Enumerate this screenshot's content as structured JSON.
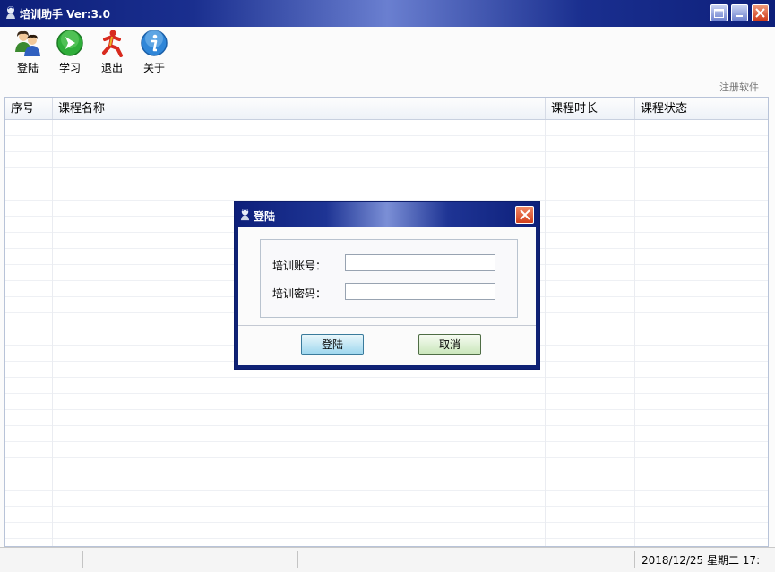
{
  "window": {
    "title": "培训助手 Ver:3.0"
  },
  "toolbar": {
    "items": [
      {
        "label": "登陆",
        "icon": "users-login-icon"
      },
      {
        "label": "学习",
        "icon": "green-arrow-play-icon"
      },
      {
        "label": "退出",
        "icon": "red-running-man-icon"
      },
      {
        "label": "关于",
        "icon": "info-icon"
      }
    ],
    "register_link": "注册软件"
  },
  "table": {
    "columns": [
      "序号",
      "课程名称",
      "课程时长",
      "课程状态"
    ],
    "rows": []
  },
  "status_bar": {
    "datetime": "2018/12/25 星期二 17:"
  },
  "login_dialog": {
    "title": "登陆",
    "account_label": "培训账号：",
    "account_value": "",
    "password_label": "培训密码：",
    "password_value": "",
    "login_button": "登陆",
    "cancel_button": "取消"
  },
  "colors": {
    "titlebar": "#0d1f7a",
    "close_button": "#d2401c",
    "grid_border": "#b8c3d8"
  }
}
